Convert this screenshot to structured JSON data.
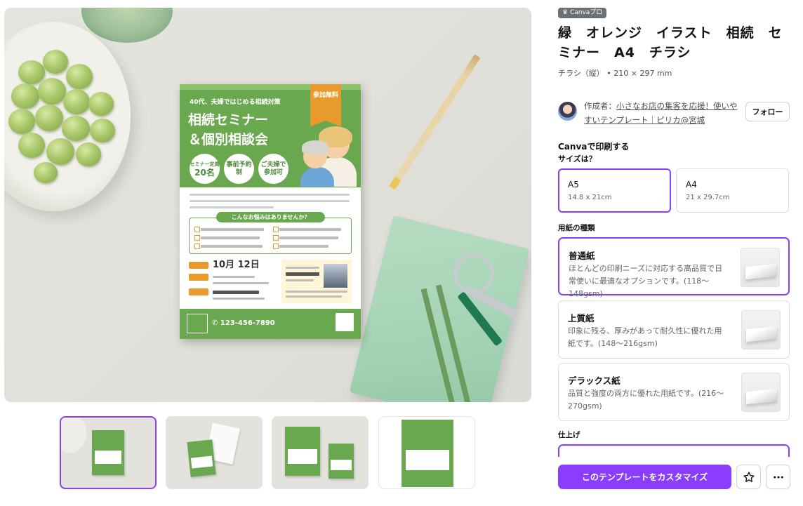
{
  "flyer": {
    "subtitle": "40代、夫婦ではじめる相続対策",
    "title_line1": "相続セミナー",
    "title_line2": "＆個別相談会",
    "free_label": "参加無料",
    "circles": [
      {
        "top": "セミナー定員",
        "main": "20名"
      },
      {
        "top": "",
        "main": "事前予約制"
      },
      {
        "top": "",
        "main": "ご夫婦で参加可"
      }
    ],
    "worry_title": "こんなお悩みはありませんか？",
    "date": "10月 12日",
    "phone": "123-456-7890"
  },
  "product": {
    "badge": "Canvaプロ",
    "title": "緑　オレンジ　イラスト　相続　セミナー　A4　チラシ",
    "meta": "チラシ（縦） • 210 × 297 mm",
    "creator_prefix": "作成者：",
    "creator_name": "小さなお店の集客を応援！使いやすいテンプレート｜ピリカ@宮城",
    "follow_label": "フォロー"
  },
  "print": {
    "heading": "Canvaで印刷する",
    "size_question": "サイズは？",
    "sizes": [
      {
        "name": "A5",
        "dim": "14.8 x 21cm"
      },
      {
        "name": "A4",
        "dim": "21 x 29.7cm"
      }
    ],
    "paper_question": "用紙の種類",
    "papers": [
      {
        "name": "普通紙",
        "desc": "ほとんどの印刷ニーズに対応する高品質で日常使いに最適なオプションです。(118〜148gsm)"
      },
      {
        "name": "上質紙",
        "desc": "印象に残る、厚みがあって耐久性に優れた用紙です。(148〜216gsm)"
      },
      {
        "name": "デラックス紙",
        "desc": "品質と強度の両方に優れた用紙です。(216〜270gsm)"
      }
    ],
    "finish_question": "仕上げ"
  },
  "actions": {
    "customize_label": "このテンプレートをカスタマイズ",
    "star_icon": "star-icon",
    "more_icon": "more-icon"
  },
  "colors": {
    "accent": "#8b3dff",
    "flyer_green": "#6aa84f",
    "flyer_orange": "#e89b2c"
  }
}
